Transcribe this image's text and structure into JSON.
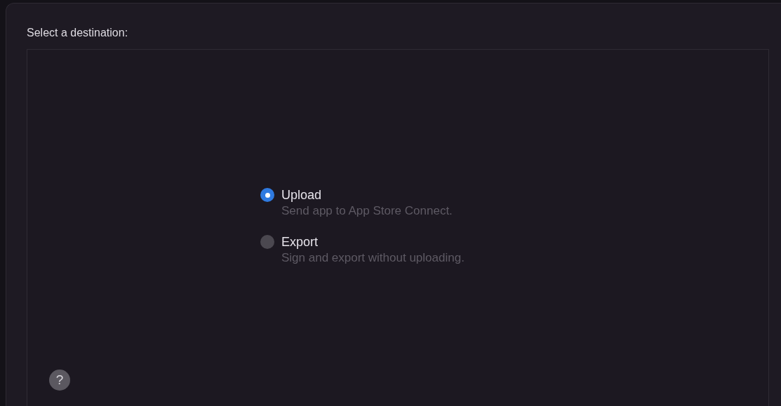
{
  "heading": "Select a destination:",
  "options": [
    {
      "label": "Upload",
      "description": "Send app to App Store Connect.",
      "selected": true
    },
    {
      "label": "Export",
      "description": "Sign and export without uploading.",
      "selected": false
    }
  ],
  "help_button": {
    "label": "?"
  }
}
